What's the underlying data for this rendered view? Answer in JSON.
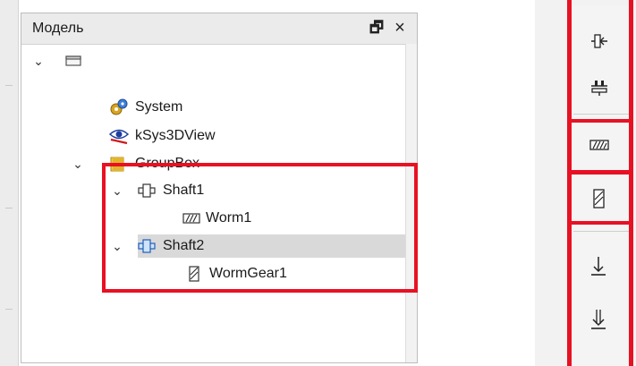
{
  "panel": {
    "title": "Модель",
    "float_glyph": "🗗",
    "close_glyph": "×"
  },
  "tree": {
    "expand_glyph": "⌄",
    "items": [
      {
        "label": "",
        "icon": "document-root-icon"
      },
      {
        "label": "System",
        "icon": "system-gears-icon"
      },
      {
        "label": "kSys3DView",
        "icon": "eye-3dview-icon"
      },
      {
        "label": "GroupBox",
        "icon": "folder-icon"
      },
      {
        "label": "Shaft1",
        "icon": "shaft-icon"
      },
      {
        "label": "Worm1",
        "icon": "worm-icon"
      },
      {
        "label": "Shaft2",
        "icon": "shaft-icon"
      },
      {
        "label": "WormGear1",
        "icon": "worm-gear-icon"
      }
    ]
  },
  "toolbar": {
    "buttons": [
      {
        "icon": "shaft-insert-icon"
      },
      {
        "icon": "support-icon"
      },
      {
        "icon": "worm-icon"
      },
      {
        "icon": "worm-gear-icon"
      },
      {
        "icon": "load-down-icon"
      },
      {
        "icon": "load-down-double-icon"
      }
    ]
  },
  "colors": {
    "highlight": "#e81123",
    "selection": "#d9d9d9",
    "panel_header": "#ebebeb"
  }
}
